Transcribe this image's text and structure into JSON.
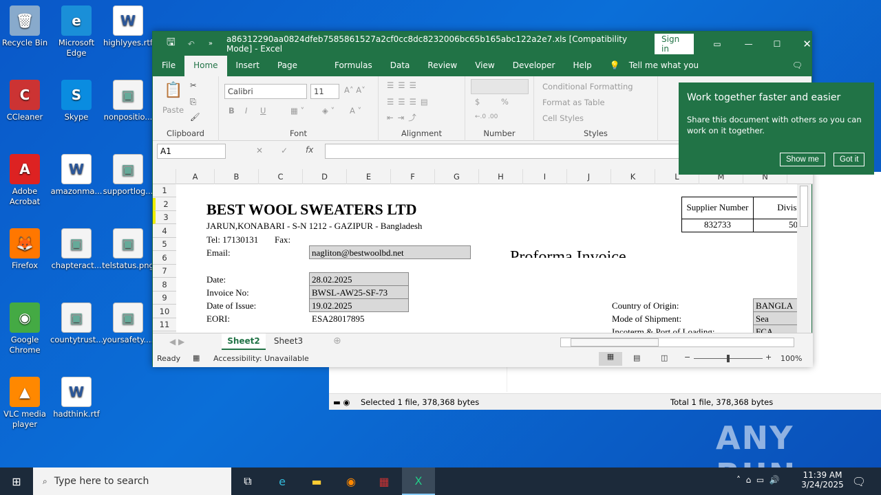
{
  "desktop": {
    "icons": [
      {
        "label": "Recycle Bin",
        "glyph": "🗑"
      },
      {
        "label": "Microsoft Edge",
        "glyph": "e"
      },
      {
        "label": "highlyyes.rtf",
        "glyph": "W"
      },
      {
        "label": "CCleaner",
        "glyph": "C"
      },
      {
        "label": "Skype",
        "glyph": "S"
      },
      {
        "label": "nonpositio...",
        "glyph": "▣"
      },
      {
        "label": "Adobe Acrobat",
        "glyph": "A"
      },
      {
        "label": "amazonma...",
        "glyph": "W"
      },
      {
        "label": "supportlog...",
        "glyph": "▣"
      },
      {
        "label": "Firefox",
        "glyph": "🦊"
      },
      {
        "label": "chapteract...",
        "glyph": "▣"
      },
      {
        "label": "telstatus.png",
        "glyph": "▣"
      },
      {
        "label": "Google Chrome",
        "glyph": "◉"
      },
      {
        "label": "countytrust...",
        "glyph": "▣"
      },
      {
        "label": "yoursafety....",
        "glyph": "▣"
      },
      {
        "label": "VLC media player",
        "glyph": "▲"
      },
      {
        "label": "hadthink.rtf",
        "glyph": "W"
      }
    ]
  },
  "explorer": {
    "status_selected": "Selected 1 file, 378,368 bytes",
    "status_total": "Total 1 file, 378,368 bytes"
  },
  "excel": {
    "title": "a86312290aa0824dfeb7585861527a2cf0cc8dc8232006bc65b165abc122a2e7.xls  [Compatibility Mode]  -  Excel",
    "sign_in": "Sign in",
    "menu": [
      "File",
      "Home",
      "Insert",
      "Page Layout",
      "Formulas",
      "Data",
      "Review",
      "View",
      "Developer",
      "Help"
    ],
    "tell_me": "Tell me what you want to do",
    "ribbon": {
      "paste": "Paste",
      "clipboard": "Clipboard",
      "font_name": "Calibri",
      "font_size": "11",
      "font": "Font",
      "alignment": "Alignment",
      "number": "Number",
      "styles": "Styles",
      "cond_format": "Conditional Formatting",
      "format_table": "Format as Table",
      "cell_styles": "Cell Styles",
      "bold": "B",
      "italic": "I",
      "underline": "U",
      "currency": "$",
      "percent": "%"
    },
    "name_box": "A1",
    "fx": "fx",
    "columns": [
      "A",
      "B",
      "C",
      "D",
      "E",
      "F",
      "G",
      "H",
      "I",
      "J",
      "K",
      "L",
      "M",
      "N"
    ],
    "rows": [
      "1",
      "2",
      "3",
      "4",
      "5",
      "6",
      "7",
      "8",
      "9",
      "10",
      "11"
    ],
    "sheet": {
      "company": "BEST WOOL SWEATERS LTD",
      "address": "JARUN,KONABARI - S-N 1212 - GAZIPUR  - Bangladesh",
      "tel": "Tel: 17130131",
      "fax": "Fax:",
      "email_label": "Email:",
      "email": "nagliton@bestwoolbd.net",
      "title": "Proforma Invoice",
      "date_label": "Date:",
      "date": "28.02.2025",
      "invoice_label": "Invoice No:",
      "invoice": "BWSL-AW25-SF-73",
      "issue_label": "Date of Issue:",
      "issue": "19.02.2025",
      "eori_label": "EORI:",
      "eori": "ESA28017895",
      "supplier_header": "Supplier Number",
      "division_header": "Divisi",
      "supplier_number": "832733",
      "division": "50",
      "origin_label": "Country of Origin:",
      "origin": "BANGLA",
      "shipment_label": "Mode of Shipment:",
      "shipment": "Sea",
      "incoterm_label": "Incoterm & Port of Loading:",
      "incoterm": "FCA"
    },
    "tabs": [
      "Sheet2",
      "Sheet3"
    ],
    "status": {
      "ready": "Ready",
      "accessibility": "Accessibility: Unavailable",
      "zoom": "100%"
    }
  },
  "popup": {
    "title": "Work together faster and easier",
    "body": "Share this document with others so you can work on it together.",
    "show_me": "Show me",
    "got_it": "Got it"
  },
  "taskbar": {
    "search_placeholder": "Type here to search",
    "time": "11:39 AM",
    "date": "3/24/2025"
  },
  "watermark": "ANY RUN"
}
